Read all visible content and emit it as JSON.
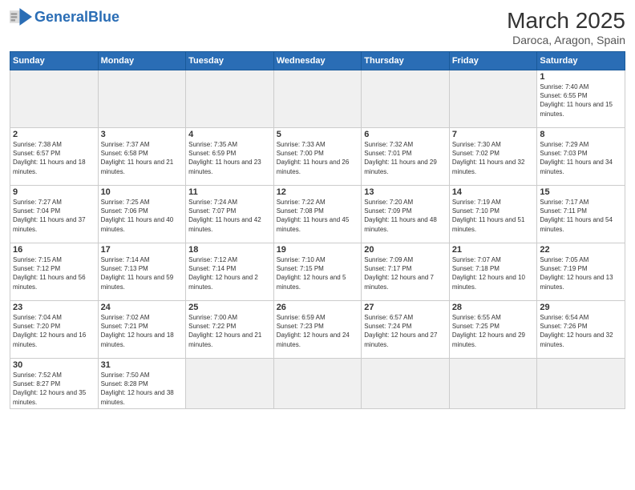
{
  "header": {
    "logo_general": "General",
    "logo_blue": "Blue",
    "month_title": "March 2025",
    "location": "Daroca, Aragon, Spain"
  },
  "weekdays": [
    "Sunday",
    "Monday",
    "Tuesday",
    "Wednesday",
    "Thursday",
    "Friday",
    "Saturday"
  ],
  "weeks": [
    [
      {
        "day": "",
        "info": ""
      },
      {
        "day": "",
        "info": ""
      },
      {
        "day": "",
        "info": ""
      },
      {
        "day": "",
        "info": ""
      },
      {
        "day": "",
        "info": ""
      },
      {
        "day": "",
        "info": ""
      },
      {
        "day": "1",
        "info": "Sunrise: 7:40 AM\nSunset: 6:55 PM\nDaylight: 11 hours and 15 minutes."
      }
    ],
    [
      {
        "day": "2",
        "info": "Sunrise: 7:38 AM\nSunset: 6:57 PM\nDaylight: 11 hours and 18 minutes."
      },
      {
        "day": "3",
        "info": "Sunrise: 7:37 AM\nSunset: 6:58 PM\nDaylight: 11 hours and 21 minutes."
      },
      {
        "day": "4",
        "info": "Sunrise: 7:35 AM\nSunset: 6:59 PM\nDaylight: 11 hours and 23 minutes."
      },
      {
        "day": "5",
        "info": "Sunrise: 7:33 AM\nSunset: 7:00 PM\nDaylight: 11 hours and 26 minutes."
      },
      {
        "day": "6",
        "info": "Sunrise: 7:32 AM\nSunset: 7:01 PM\nDaylight: 11 hours and 29 minutes."
      },
      {
        "day": "7",
        "info": "Sunrise: 7:30 AM\nSunset: 7:02 PM\nDaylight: 11 hours and 32 minutes."
      },
      {
        "day": "8",
        "info": "Sunrise: 7:29 AM\nSunset: 7:03 PM\nDaylight: 11 hours and 34 minutes."
      }
    ],
    [
      {
        "day": "9",
        "info": "Sunrise: 7:27 AM\nSunset: 7:04 PM\nDaylight: 11 hours and 37 minutes."
      },
      {
        "day": "10",
        "info": "Sunrise: 7:25 AM\nSunset: 7:06 PM\nDaylight: 11 hours and 40 minutes."
      },
      {
        "day": "11",
        "info": "Sunrise: 7:24 AM\nSunset: 7:07 PM\nDaylight: 11 hours and 42 minutes."
      },
      {
        "day": "12",
        "info": "Sunrise: 7:22 AM\nSunset: 7:08 PM\nDaylight: 11 hours and 45 minutes."
      },
      {
        "day": "13",
        "info": "Sunrise: 7:20 AM\nSunset: 7:09 PM\nDaylight: 11 hours and 48 minutes."
      },
      {
        "day": "14",
        "info": "Sunrise: 7:19 AM\nSunset: 7:10 PM\nDaylight: 11 hours and 51 minutes."
      },
      {
        "day": "15",
        "info": "Sunrise: 7:17 AM\nSunset: 7:11 PM\nDaylight: 11 hours and 54 minutes."
      }
    ],
    [
      {
        "day": "16",
        "info": "Sunrise: 7:15 AM\nSunset: 7:12 PM\nDaylight: 11 hours and 56 minutes."
      },
      {
        "day": "17",
        "info": "Sunrise: 7:14 AM\nSunset: 7:13 PM\nDaylight: 11 hours and 59 minutes."
      },
      {
        "day": "18",
        "info": "Sunrise: 7:12 AM\nSunset: 7:14 PM\nDaylight: 12 hours and 2 minutes."
      },
      {
        "day": "19",
        "info": "Sunrise: 7:10 AM\nSunset: 7:15 PM\nDaylight: 12 hours and 5 minutes."
      },
      {
        "day": "20",
        "info": "Sunrise: 7:09 AM\nSunset: 7:17 PM\nDaylight: 12 hours and 7 minutes."
      },
      {
        "day": "21",
        "info": "Sunrise: 7:07 AM\nSunset: 7:18 PM\nDaylight: 12 hours and 10 minutes."
      },
      {
        "day": "22",
        "info": "Sunrise: 7:05 AM\nSunset: 7:19 PM\nDaylight: 12 hours and 13 minutes."
      }
    ],
    [
      {
        "day": "23",
        "info": "Sunrise: 7:04 AM\nSunset: 7:20 PM\nDaylight: 12 hours and 16 minutes."
      },
      {
        "day": "24",
        "info": "Sunrise: 7:02 AM\nSunset: 7:21 PM\nDaylight: 12 hours and 18 minutes."
      },
      {
        "day": "25",
        "info": "Sunrise: 7:00 AM\nSunset: 7:22 PM\nDaylight: 12 hours and 21 minutes."
      },
      {
        "day": "26",
        "info": "Sunrise: 6:59 AM\nSunset: 7:23 PM\nDaylight: 12 hours and 24 minutes."
      },
      {
        "day": "27",
        "info": "Sunrise: 6:57 AM\nSunset: 7:24 PM\nDaylight: 12 hours and 27 minutes."
      },
      {
        "day": "28",
        "info": "Sunrise: 6:55 AM\nSunset: 7:25 PM\nDaylight: 12 hours and 29 minutes."
      },
      {
        "day": "29",
        "info": "Sunrise: 6:54 AM\nSunset: 7:26 PM\nDaylight: 12 hours and 32 minutes."
      }
    ],
    [
      {
        "day": "30",
        "info": "Sunrise: 7:52 AM\nSunset: 8:27 PM\nDaylight: 12 hours and 35 minutes."
      },
      {
        "day": "31",
        "info": "Sunrise: 7:50 AM\nSunset: 8:28 PM\nDaylight: 12 hours and 38 minutes."
      },
      {
        "day": "",
        "info": ""
      },
      {
        "day": "",
        "info": ""
      },
      {
        "day": "",
        "info": ""
      },
      {
        "day": "",
        "info": ""
      },
      {
        "day": "",
        "info": ""
      }
    ]
  ]
}
